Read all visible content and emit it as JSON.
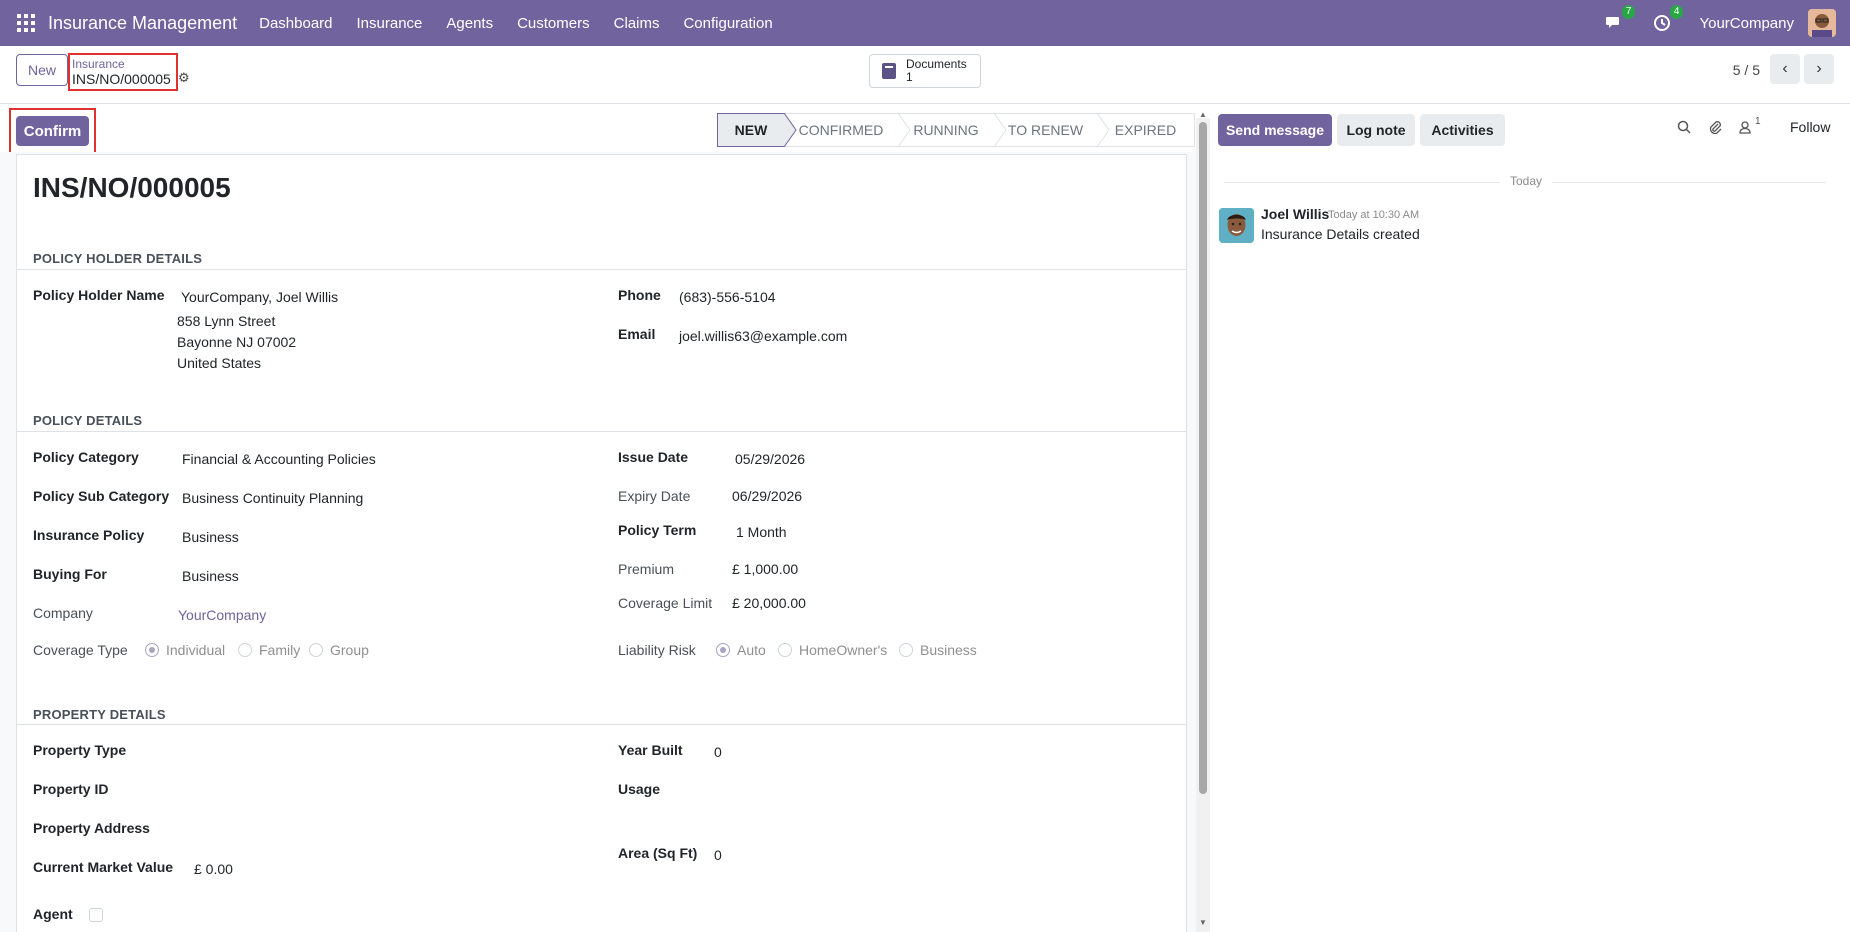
{
  "navbar": {
    "app_name": "Insurance Management",
    "menu": [
      "Dashboard",
      "Insurance",
      "Agents",
      "Customers",
      "Claims",
      "Configuration"
    ],
    "messages_badge": "7",
    "activities_badge": "4",
    "company": "YourCompany"
  },
  "control": {
    "new_label": "New",
    "breadcrumb_parent": "Insurance",
    "breadcrumb_current": "INS/NO/000005",
    "documents_label": "Documents",
    "documents_count": "1",
    "pager": "5 / 5"
  },
  "statusbar": {
    "confirm_label": "Confirm",
    "stages": [
      "NEW",
      "CONFIRMED",
      "RUNNING",
      "TO RENEW",
      "EXPIRED"
    ],
    "active_stage": "NEW"
  },
  "form": {
    "title": "INS/NO/000005",
    "policy_holder": {
      "section": "POLICY HOLDER DETAILS",
      "name_label": "Policy Holder Name",
      "name_value": "YourCompany, Joel Willis",
      "address_line1": "858 Lynn Street",
      "address_line2": "Bayonne NJ 07002",
      "address_line3": "United States",
      "phone_label": "Phone",
      "phone_value": "(683)-556-5104",
      "email_label": "Email",
      "email_value": "joel.willis63@example.com"
    },
    "policy": {
      "section": "POLICY DETAILS",
      "category_label": "Policy Category",
      "category_value": "Financial & Accounting Policies",
      "sub_category_label": "Policy Sub Category",
      "sub_category_value": "Business Continuity Planning",
      "insurance_policy_label": "Insurance Policy",
      "insurance_policy_value": "Business",
      "buying_for_label": "Buying For",
      "buying_for_value": "Business",
      "company_label": "Company",
      "company_value": "YourCompany",
      "coverage_type_label": "Coverage Type",
      "coverage_type_options": [
        "Individual",
        "Family",
        "Group"
      ],
      "coverage_type_selected": "Individual",
      "issue_date_label": "Issue Date",
      "issue_date_value": "05/29/2026",
      "expiry_date_label": "Expiry Date",
      "expiry_date_value": "06/29/2026",
      "policy_term_label": "Policy Term",
      "policy_term_value": "1 Month",
      "premium_label": "Premium",
      "premium_value": "£ 1,000.00",
      "coverage_limit_label": "Coverage Limit",
      "coverage_limit_value": "£ 20,000.00",
      "liability_risk_label": "Liability Risk",
      "liability_risk_options": [
        "Auto",
        "HomeOwner's",
        "Business"
      ],
      "liability_risk_selected": "Auto"
    },
    "property": {
      "section": "PROPERTY DETAILS",
      "type_label": "Property Type",
      "id_label": "Property ID",
      "address_label": "Property Address",
      "market_value_label": "Current Market Value",
      "market_value_value": "£ 0.00",
      "agent_label": "Agent",
      "year_built_label": "Year Built",
      "year_built_value": "0",
      "usage_label": "Usage",
      "area_label": "Area (Sq Ft)",
      "area_value": "0"
    }
  },
  "chatter": {
    "send_message": "Send message",
    "log_note": "Log note",
    "activities": "Activities",
    "followers_count": "1",
    "follow": "Follow",
    "date_separator": "Today",
    "message": {
      "author": "Joel Willis",
      "time": "Today at 10:30 AM",
      "body": "Insurance Details created"
    }
  },
  "colors": {
    "brand": "#71639e",
    "highlight_box": "#e03131",
    "badge": "#28a745"
  }
}
